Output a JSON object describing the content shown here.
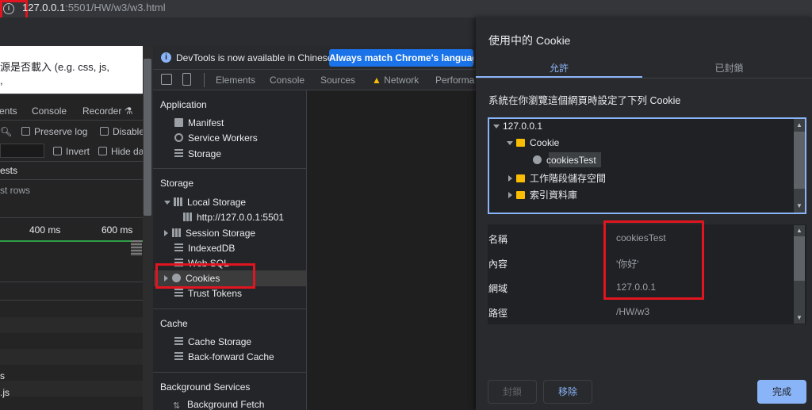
{
  "address_bar": {
    "url_host": "127.0.0.1",
    "url_path": ":5501/HW/w3/w3.html",
    "info_icon": "info-icon"
  },
  "page": {
    "text_line1": "源是否載入 (e.g. css, js,",
    "text_line2": ","
  },
  "inner_devtools": {
    "tabs": [
      "ents",
      "Console",
      "Recorder"
    ],
    "preserve_log": "Preserve log",
    "disable": "Disable",
    "invert": "Invert",
    "hide_data": "Hide da",
    "ests": "ests",
    "st_rows": "st rows",
    "tick_400": "400 ms",
    "tick_600": "600 ms",
    "file_s": "s",
    "file_js": ".js"
  },
  "devtools": {
    "banner_text": "DevTools is now available in Chinese!",
    "banner_button": "Always match Chrome's language",
    "tabs": [
      "Elements",
      "Console",
      "Sources",
      "Network",
      "Performan"
    ],
    "sections": {
      "application": {
        "title": "Application",
        "items": [
          "Manifest",
          "Service Workers",
          "Storage"
        ]
      },
      "storage": {
        "title": "Storage",
        "local_storage": "Local Storage",
        "local_storage_child": "http://127.0.0.1:5501",
        "session_storage": "Session Storage",
        "indexeddb": "IndexedDB",
        "websql": "Web SQL",
        "cookies": "Cookies",
        "trust_tokens": "Trust Tokens"
      },
      "cache": {
        "title": "Cache",
        "items": [
          "Cache Storage",
          "Back-forward Cache"
        ]
      },
      "background": {
        "title": "Background Services",
        "items": [
          "Background Fetch"
        ]
      }
    }
  },
  "cookie_dialog": {
    "title": "使用中的 Cookie",
    "tab_allowed": "允許",
    "tab_blocked": "已封鎖",
    "description": "系統在你瀏覽這個網頁時設定了下列 Cookie",
    "tree": {
      "root": "127.0.0.1",
      "cookie_folder": "Cookie",
      "cookie_item": "cookiesTest",
      "session_storage": "工作階段儲存空間",
      "indexed_db": "索引資料庫"
    },
    "details": [
      {
        "label": "名稱",
        "value": "cookiesTest"
      },
      {
        "label": "內容",
        "value": "'你好'"
      },
      {
        "label": "網域",
        "value": "127.0.0.1"
      },
      {
        "label": "路徑",
        "value": "/HW/w3"
      }
    ],
    "buttons": {
      "block": "封鎖",
      "remove": "移除",
      "done": "完成"
    }
  },
  "colors": {
    "highlight": "#e0151f",
    "accent": "#8ab4f8",
    "primary_button": "#1a73e8"
  }
}
